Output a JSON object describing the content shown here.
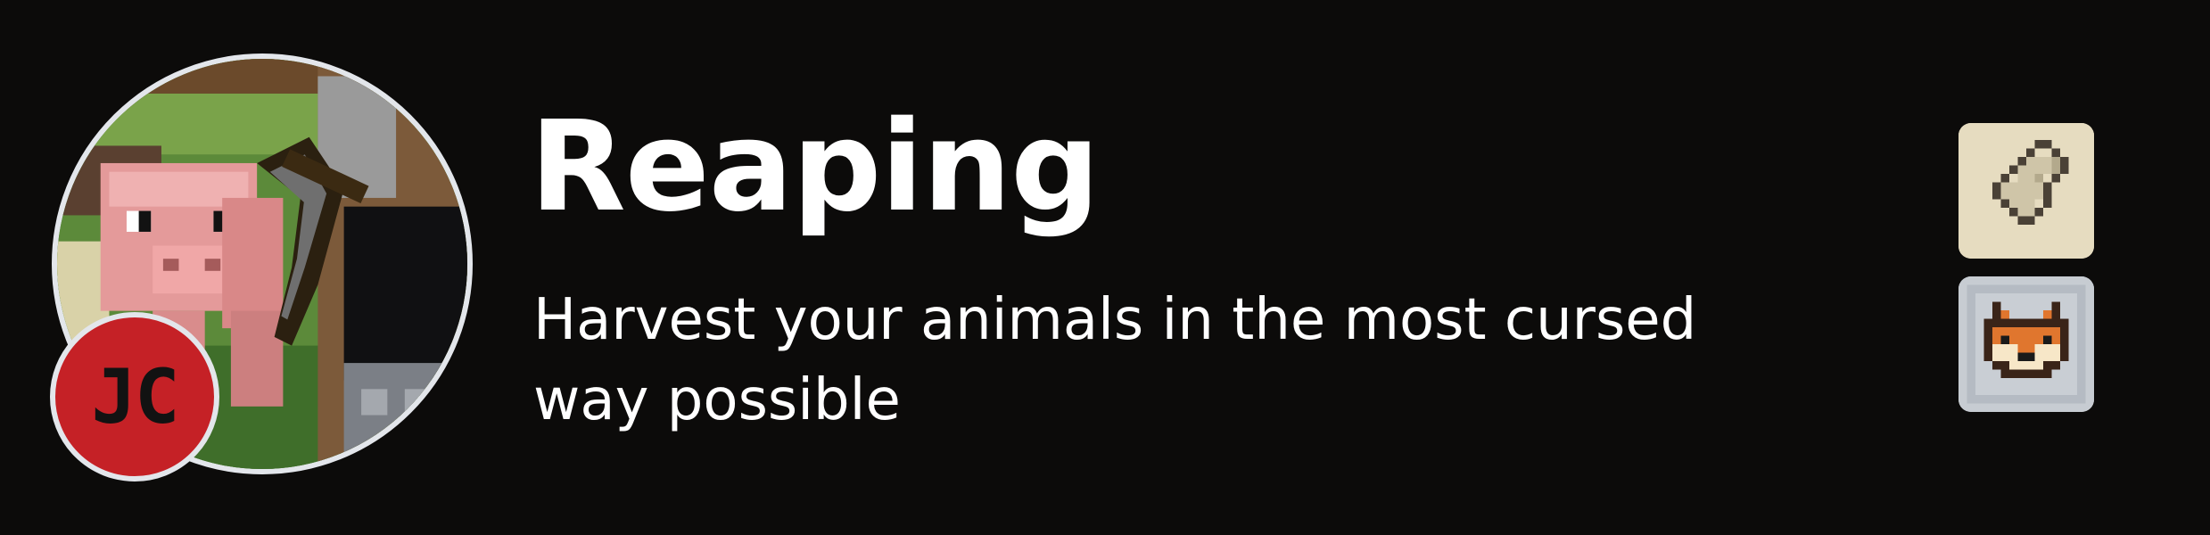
{
  "project": {
    "title": "Reaping",
    "summary": "Harvest your animals in the most cursed way possible"
  },
  "author": {
    "initials": "JC",
    "badge_color": "#c52126"
  },
  "categories": [
    {
      "icon": "paper-icon"
    },
    {
      "icon": "fox-icon"
    }
  ],
  "colors": {
    "background": "#0c0b0a",
    "text": "#ffffff",
    "avatar_border": "#e3e6eb"
  }
}
